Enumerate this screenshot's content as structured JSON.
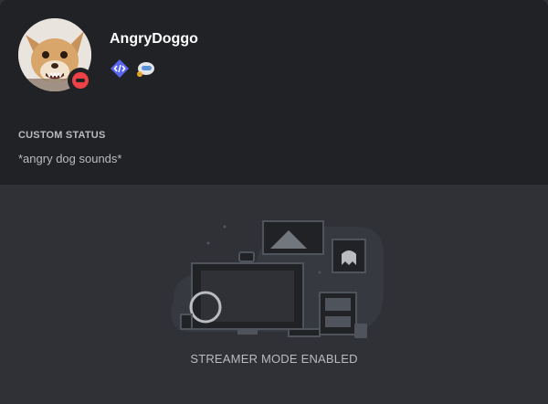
{
  "profile": {
    "username": "AngryDoggo",
    "status": "dnd",
    "status_color": "#ed4245",
    "badges": [
      {
        "icon": "developer-code-icon",
        "color": "#5865f2"
      },
      {
        "icon": "nitro-badge-icon",
        "color": "#b9bbbe"
      }
    ]
  },
  "custom_status": {
    "title": "CUSTOM STATUS",
    "text": "*angry dog sounds*"
  },
  "streamer": {
    "label": "STREAMER MODE ENABLED"
  },
  "colors": {
    "header_bg": "#202225",
    "body_bg": "#2f3136",
    "text_muted": "#b9bbbe"
  }
}
